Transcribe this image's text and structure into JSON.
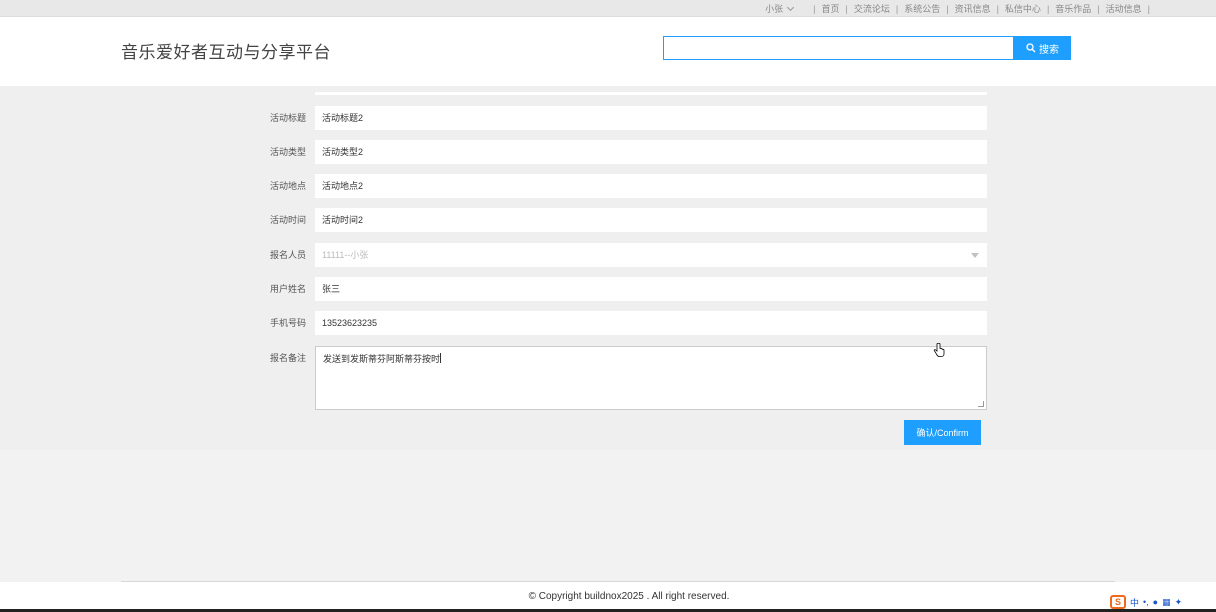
{
  "topbar": {
    "user": "小张",
    "nav": [
      "首页",
      "交流论坛",
      "系统公告",
      "资讯信息",
      "私信中心",
      "音乐作品",
      "活动信息"
    ],
    "active": "活动信息"
  },
  "header": {
    "site_title": "音乐爱好者互动与分享平台",
    "search_value": "",
    "search_button": "搜索"
  },
  "form": {
    "fields": [
      {
        "label": "活动标题",
        "value": "活动标题2"
      },
      {
        "label": "活动类型",
        "value": "活动类型2"
      },
      {
        "label": "活动地点",
        "value": "活动地点2"
      },
      {
        "label": "活动时间",
        "value": "活动时间2"
      },
      {
        "label": "报名人员",
        "value": "11111--小张"
      },
      {
        "label": "用户姓名",
        "value": "张三"
      },
      {
        "label": "手机号码",
        "value": "13523623235"
      }
    ],
    "remark_label": "报名备注",
    "remark_value": "发送到发斯蒂芬阿斯蒂芬按时",
    "confirm_button": "确认/Confirm"
  },
  "footer": {
    "copyright": "© Copyright buildnox2025 . All right reserved."
  },
  "ime": {
    "logo": "S",
    "mode": "中"
  },
  "colors": {
    "primary": "#1e9fff",
    "active_underline": "#5fb878"
  }
}
